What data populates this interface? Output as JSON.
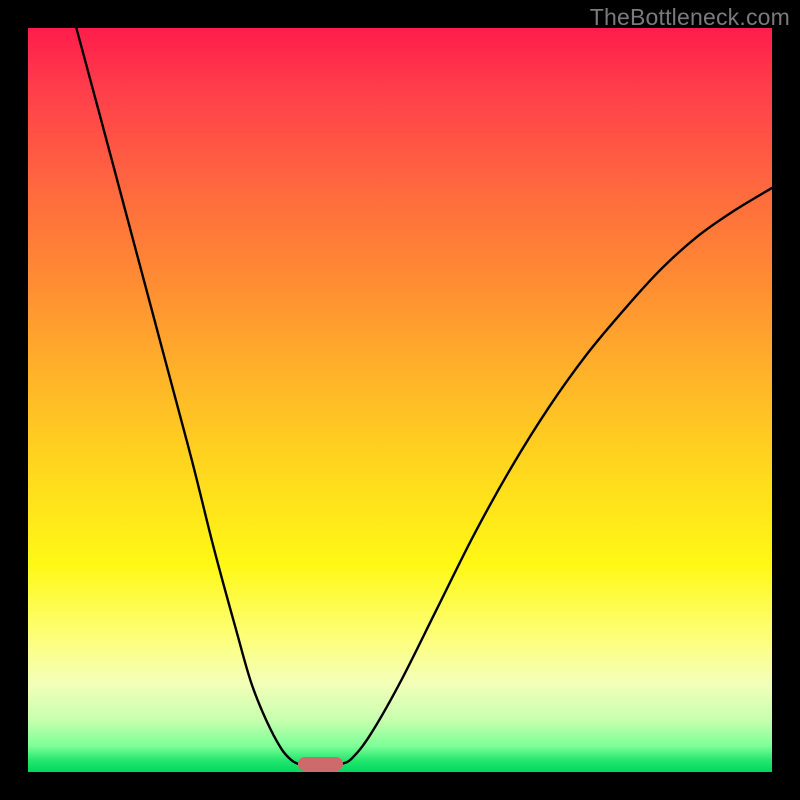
{
  "watermark": "TheBottleneck.com",
  "chart_data": {
    "type": "line",
    "title": "",
    "xlabel": "",
    "ylabel": "",
    "xlim": [
      0,
      100
    ],
    "ylim": [
      0,
      100
    ],
    "series": [
      {
        "name": "left-branch",
        "x": [
          6.5,
          10,
          14,
          18,
          22,
          25,
          28,
          30,
          32,
          34,
          35.4,
          36.3
        ],
        "y": [
          100,
          87,
          72,
          57,
          42,
          30,
          19,
          12,
          7,
          3.2,
          1.6,
          1.1
        ]
      },
      {
        "name": "right-branch",
        "x": [
          42.2,
          43.5,
          46,
          50,
          55,
          60,
          65,
          70,
          75,
          80,
          85,
          90,
          95,
          100
        ],
        "y": [
          1.1,
          1.8,
          5,
          12,
          22,
          32,
          41,
          49,
          56,
          62,
          67.5,
          72,
          75.5,
          78.5
        ]
      }
    ],
    "marker": {
      "x_center": 39.3,
      "y": 1.1,
      "width_pct": 6
    },
    "gradient_stops": [
      {
        "pct": 0,
        "color": "#ff1d4b"
      },
      {
        "pct": 50,
        "color": "#ffd41f"
      },
      {
        "pct": 100,
        "color": "#00d85e"
      }
    ]
  }
}
